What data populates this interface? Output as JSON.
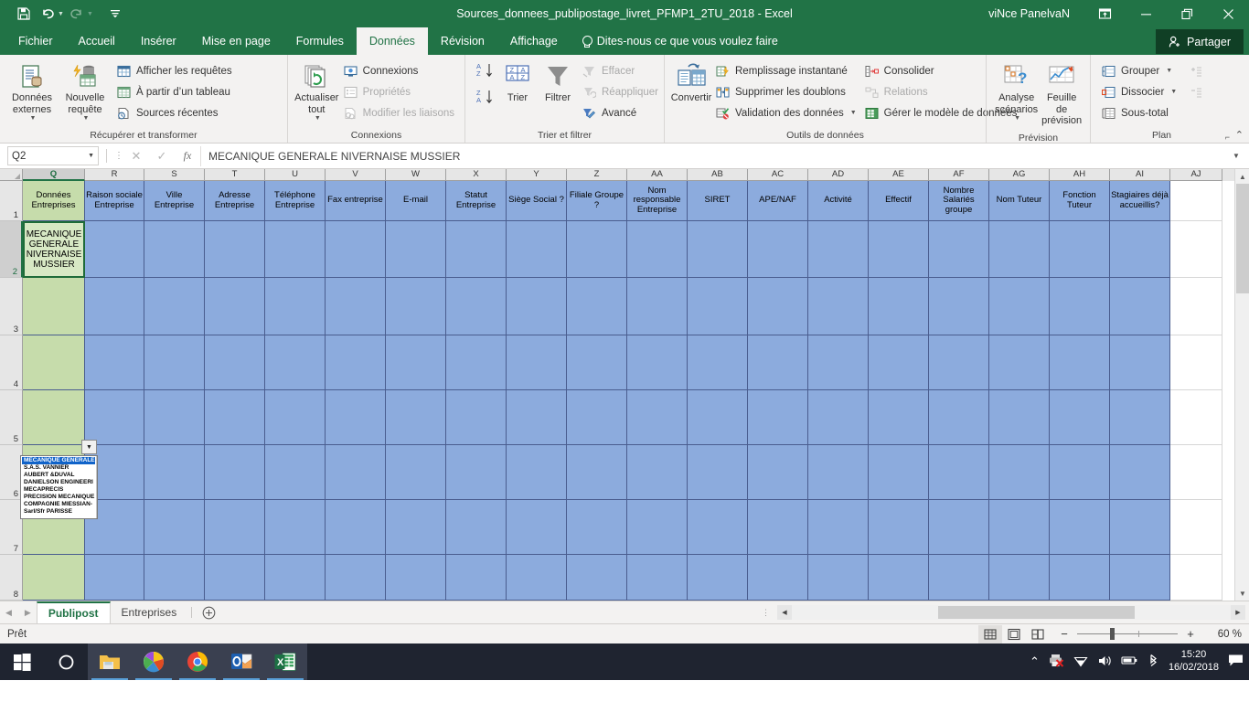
{
  "titlebar": {
    "save_icon": "save-icon",
    "undo_icon": "undo-icon",
    "redo_icon": "redo-icon",
    "customize_icon": "customize-quick-access-icon",
    "document_title": "Sources_donnees_publipostage_livret_PFMP1_2TU_2018  -  Excel",
    "username": "viNce PanelvaN",
    "ribbon_display_icon": "ribbon-display-options-icon",
    "minimize_icon": "minimize-icon",
    "restore_icon": "restore-icon",
    "close_icon": "close-icon"
  },
  "ribbon_tabs": {
    "items": [
      {
        "label": "Fichier",
        "active": false
      },
      {
        "label": "Accueil",
        "active": false
      },
      {
        "label": "Insérer",
        "active": false
      },
      {
        "label": "Mise en page",
        "active": false
      },
      {
        "label": "Formules",
        "active": false
      },
      {
        "label": "Données",
        "active": true
      },
      {
        "label": "Révision",
        "active": false
      },
      {
        "label": "Affichage",
        "active": false
      }
    ],
    "tellme": "Dites-nous ce que vous voulez faire",
    "share": "Partager"
  },
  "ribbon": {
    "groups": [
      {
        "name": "Récupérer et transformer",
        "big": [
          {
            "label": "Données\nexternes",
            "icon": "external-data-icon",
            "caret": true
          },
          {
            "label": "Nouvelle\nrequête",
            "icon": "new-query-icon",
            "caret": true
          }
        ],
        "small": [
          {
            "label": "Afficher les requêtes",
            "icon": "show-queries-icon",
            "disabled": false
          },
          {
            "label": "À partir d’un tableau",
            "icon": "from-table-icon",
            "disabled": false
          },
          {
            "label": "Sources récentes",
            "icon": "recent-sources-icon",
            "disabled": false
          }
        ]
      },
      {
        "name": "Connexions",
        "big": [
          {
            "label": "Actualiser\ntout",
            "icon": "refresh-all-icon",
            "caret": true
          }
        ],
        "small": [
          {
            "label": "Connexions",
            "icon": "connections-icon",
            "disabled": false
          },
          {
            "label": "Propriétés",
            "icon": "properties-icon",
            "disabled": true
          },
          {
            "label": "Modifier les liaisons",
            "icon": "edit-links-icon",
            "disabled": true
          }
        ]
      },
      {
        "name": "Trier et filtrer",
        "big": [
          {
            "label": "Trier",
            "icon": "sort-icon",
            "caret": false
          },
          {
            "label": "Filtrer",
            "icon": "filter-icon",
            "caret": false
          }
        ],
        "small": [
          {
            "label": "Effacer",
            "icon": "clear-filter-icon",
            "disabled": true
          },
          {
            "label": "Réappliquer",
            "icon": "reapply-icon",
            "disabled": true
          },
          {
            "label": "Avancé",
            "icon": "advanced-filter-icon",
            "disabled": false
          }
        ]
      },
      {
        "name": "Outils de données",
        "big": [
          {
            "label": "Convertir",
            "icon": "text-to-columns-icon",
            "caret": false
          }
        ],
        "small": [
          {
            "label": "Remplissage instantané",
            "icon": "flash-fill-icon",
            "disabled": false
          },
          {
            "label": "Supprimer les doublons",
            "icon": "remove-duplicates-icon",
            "disabled": false
          },
          {
            "label": "Validation des données",
            "icon": "data-validation-icon",
            "disabled": false,
            "caret": true
          }
        ],
        "small2": [
          {
            "label": "Consolider",
            "icon": "consolidate-icon",
            "disabled": false
          },
          {
            "label": "Relations",
            "icon": "relationships-icon",
            "disabled": true
          },
          {
            "label": "Gérer le modèle de données",
            "icon": "manage-data-model-icon",
            "disabled": false
          }
        ]
      },
      {
        "name": "Prévision",
        "big": [
          {
            "label": "Analyse\nscénarios",
            "icon": "what-if-analysis-icon",
            "caret": true
          },
          {
            "label": "Feuille de\nprévision",
            "icon": "forecast-sheet-icon",
            "caret": false
          }
        ],
        "small": []
      },
      {
        "name": "Plan",
        "big": [],
        "small": [
          {
            "label": "Grouper",
            "icon": "group-icon",
            "disabled": false,
            "caret": true
          },
          {
            "label": "Dissocier",
            "icon": "ungroup-icon",
            "disabled": false,
            "caret": true
          },
          {
            "label": "Sous-total",
            "icon": "subtotal-icon",
            "disabled": false
          }
        ],
        "small2": [
          {
            "label": "",
            "icon": "show-detail-icon",
            "disabled": true
          },
          {
            "label": "",
            "icon": "hide-detail-icon",
            "disabled": true
          }
        ],
        "launcher": true
      }
    ],
    "collapse_icon": "collapse-ribbon-icon"
  },
  "formula_bar": {
    "name_box_value": "Q2",
    "name_box_caret_icon": "chevron-down-icon",
    "cancel_icon": "cancel-icon",
    "confirm_icon": "confirm-icon",
    "function_icon": "insert-function-icon",
    "formula_value": "MECANIQUE GENERALE NIVERNAISE MUSSIER",
    "expand_icon": "expand-formula-bar-icon"
  },
  "sheet": {
    "columns": [
      {
        "letter": "Q",
        "width": 68,
        "header": "Données Entreprises",
        "selected": true
      },
      {
        "letter": "R",
        "width": 65,
        "header": "Raison sociale Entreprise",
        "selected": false
      },
      {
        "letter": "S",
        "width": 66,
        "header": "Ville Entreprise",
        "selected": false
      },
      {
        "letter": "T",
        "width": 66,
        "header": "Adresse Entreprise",
        "selected": false
      },
      {
        "letter": "U",
        "width": 66,
        "header": "Téléphone Entreprise",
        "selected": false
      },
      {
        "letter": "V",
        "width": 66,
        "header": "Fax entreprise",
        "selected": false
      },
      {
        "letter": "W",
        "width": 66,
        "header": "E-mail",
        "selected": false
      },
      {
        "letter": "X",
        "width": 66,
        "header": "Statut Entreprise",
        "selected": false
      },
      {
        "letter": "Y",
        "width": 66,
        "header": "Siège Social ?",
        "selected": false
      },
      {
        "letter": "Z",
        "width": 66,
        "header": "Filiale Groupe ?",
        "selected": false
      },
      {
        "letter": "AA",
        "width": 66,
        "header": "Nom responsable Entreprise",
        "selected": false
      },
      {
        "letter": "AB",
        "width": 66,
        "header": "SIRET",
        "selected": false
      },
      {
        "letter": "AC",
        "width": 66,
        "header": "APE/NAF",
        "selected": false
      },
      {
        "letter": "AD",
        "width": 66,
        "header": "Activité",
        "selected": false
      },
      {
        "letter": "AE",
        "width": 66,
        "header": "Effectif",
        "selected": false
      },
      {
        "letter": "AF",
        "width": 66,
        "header": "Nombre Salariés groupe",
        "selected": false
      },
      {
        "letter": "AG",
        "width": 66,
        "header": "Nom Tuteur",
        "selected": false
      },
      {
        "letter": "AH",
        "width": 66,
        "header": "Fonction Tuteur",
        "selected": false
      },
      {
        "letter": "AI",
        "width": 66,
        "header": "Stagiaires déjà accueillis?",
        "selected": false
      },
      {
        "letter": "AJ",
        "width": 57,
        "header": "",
        "selected": false
      }
    ],
    "rows": [
      {
        "number": "1",
        "height": 44,
        "type": "header",
        "selected": false
      },
      {
        "number": "2",
        "height": 62,
        "type": "data",
        "selected": true
      },
      {
        "number": "3",
        "height": 63,
        "type": "data",
        "selected": false
      },
      {
        "number": "4",
        "height": 60,
        "type": "data",
        "selected": false
      },
      {
        "number": "5",
        "height": 60,
        "type": "data",
        "selected": false
      },
      {
        "number": "6",
        "height": 60,
        "type": "data",
        "selected": false
      },
      {
        "number": "7",
        "height": 60,
        "type": "data",
        "selected": false
      },
      {
        "number": "8",
        "height": 50,
        "type": "data",
        "selected": false
      }
    ],
    "selected_cell_value": "MECANIQUE GENERALE NIVERNAISE MUSSIER",
    "dropdown": {
      "arrow_icon": "dropdown-arrow-icon",
      "scroll_up_icon": "scroll-up-icon",
      "scroll_down_icon": "scroll-down-icon",
      "items": [
        {
          "label": "MECANIQUE GENERALE",
          "selected": true
        },
        {
          "label": "S.A.S. VANNIER",
          "selected": false
        },
        {
          "label": "AUBERT &DUVAL",
          "selected": false
        },
        {
          "label": "DANIELSON ENGINEERI",
          "selected": false
        },
        {
          "label": "MECAPRECIS",
          "selected": false
        },
        {
          "label": "PRECISION MECANIQUE",
          "selected": false
        },
        {
          "label": "COMPAGNIE MIESSIAN-",
          "selected": false
        },
        {
          "label": "Sarl/Sfr PARISSE",
          "selected": false
        }
      ]
    },
    "vscroll": {
      "up_icon": "scroll-up-icon",
      "down_icon": "scroll-down-icon"
    }
  },
  "sheet_tabs": {
    "prev_icon": "previous-sheet-icon",
    "next_icon": "next-sheet-icon",
    "tabs": [
      {
        "label": "Publipost",
        "active": true
      },
      {
        "label": "Entreprises",
        "active": false
      }
    ],
    "add_icon": "add-sheet-icon",
    "hscroll": {
      "left_icon": "scroll-left-icon",
      "right_icon": "scroll-right-icon"
    }
  },
  "status_bar": {
    "status": "Prêt",
    "views": [
      {
        "name": "normal-view-icon",
        "active": true
      },
      {
        "name": "page-layout-view-icon",
        "active": false
      },
      {
        "name": "page-break-view-icon",
        "active": false
      }
    ],
    "zoom_out_icon": "zoom-out-icon",
    "zoom_in_icon": "zoom-in-icon",
    "zoom_value": "60 %"
  },
  "taskbar": {
    "items": [
      {
        "name": "start-button-icon",
        "open": false
      },
      {
        "name": "cortana-search-icon",
        "open": false
      },
      {
        "name": "file-explorer-icon",
        "open": true
      },
      {
        "name": "picasa-icon",
        "open": true
      },
      {
        "name": "google-chrome-icon",
        "open": true
      },
      {
        "name": "outlook-icon",
        "open": true
      },
      {
        "name": "excel-icon",
        "open": true
      }
    ],
    "tray": [
      {
        "name": "show-hidden-icons-icon"
      },
      {
        "name": "printer-error-icon"
      },
      {
        "name": "wifi-icon"
      },
      {
        "name": "volume-icon"
      },
      {
        "name": "battery-icon"
      },
      {
        "name": "bluetooth-icon"
      }
    ],
    "time": "15:20",
    "date": "16/02/2018",
    "action_center_icon": "action-center-icon"
  },
  "colors": {
    "excel_green": "#217346",
    "header_blue": "#8cabdd",
    "green_col": "#c6dcab",
    "selection_green": "#1e6b39"
  }
}
